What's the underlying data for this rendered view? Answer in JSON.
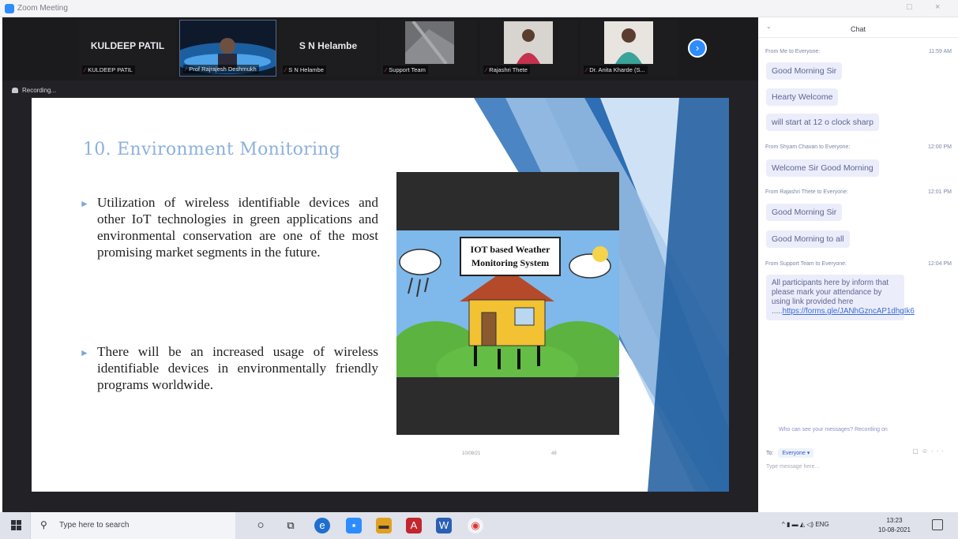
{
  "window": {
    "title": "Zoom Meeting",
    "minimize": "□",
    "close": "×"
  },
  "participants": [
    {
      "display": "KULDEEP PATIL",
      "name": "KULDEEP PATIL",
      "video": false
    },
    {
      "display": "",
      "name": "Prof Rajrajesh Deshmukh",
      "video": true
    },
    {
      "display": "S N Helambe",
      "name": "S N Helambe",
      "video": false
    },
    {
      "display": "",
      "name": "Support Team",
      "video": true
    },
    {
      "display": "",
      "name": "Rajashri Thete",
      "video": true
    },
    {
      "display": "",
      "name": "Dr. Anita Kharde (S...",
      "video": true
    }
  ],
  "next_page_icon": "chevron-right",
  "recording_label": "Recording...",
  "slide": {
    "title": "10. Environment Monitoring",
    "bullets": [
      "Utilization of wireless identifiable devices and other IoT technologies in green applications and environmental conservation are one of the most promising market segments in the future.",
      "There will be an increased usage of wireless identifiable devices in environmentally friendly programs worldwide."
    ],
    "figure_label_line1": "IOT based Weather",
    "figure_label_line2": "Monitoring System",
    "footer_date": "10/08/21",
    "footer_page": "48"
  },
  "chat": {
    "title": "Chat",
    "messages": [
      {
        "sender": "From Me to Everyone:",
        "time": "11:59 AM",
        "texts": [
          "Good Morning Sir",
          "Hearty Welcome",
          "will start at 12 o clock sharp"
        ]
      },
      {
        "sender": "From Shyam Chavan to Everyone:",
        "time": "12:00 PM",
        "texts": [
          "Welcome Sir  Good Morning"
        ]
      },
      {
        "sender": "From Rajashri Thete to Everyone:",
        "time": "12:01 PM",
        "texts": [
          "Good Morning Sir",
          "Good Morning to all"
        ]
      },
      {
        "sender": "From Support Team to Everyone:",
        "time": "12:04 PM",
        "texts": []
      }
    ],
    "long_message": "All participants here by inform that please mark your attendance by using link provided here .....",
    "long_message_link": "https://forms.gle/JANhGzncAP1dhgIk6",
    "privacy_note": "Who can see your messages? Recording on",
    "to_label": "To:",
    "to_value": "Everyone ▾",
    "compose_placeholder": "Type message here..."
  },
  "taskbar": {
    "search_placeholder": "Type here to search",
    "apps": [
      "cortana",
      "task-view",
      "edge",
      "zoom",
      "file-explorer",
      "acrobat",
      "word",
      "chrome"
    ],
    "tray_lang": "ENG",
    "time": "13:23",
    "date": "10-08-2021"
  },
  "colors": {
    "zoom_blue": "#2d8cff",
    "slide_title": "#8cb1dd",
    "chat_bubble": "#ecedfa",
    "chat_text": "#5e6494",
    "meeting_bg": "#222226"
  }
}
